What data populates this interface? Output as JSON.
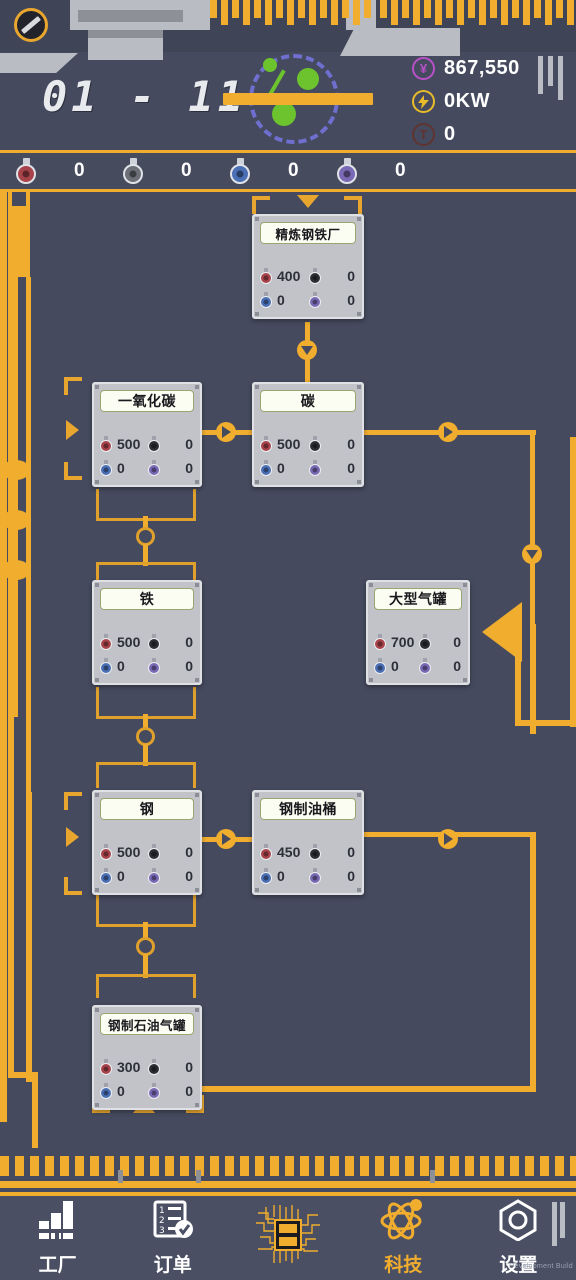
{
  "header": {
    "level_label": "01 - 11",
    "knob_icon": "dial-knob-icon",
    "logo_icon": "molecule-logo-icon",
    "stats": [
      {
        "icon": "money-icon",
        "symbol": "¥",
        "value": "867,550",
        "color": "#b851c8"
      },
      {
        "icon": "power-icon",
        "symbol": "⚡",
        "value": "0KW",
        "color": "#e8bb2b"
      },
      {
        "icon": "pollution-icon",
        "symbol": "T",
        "value": "0",
        "color": "#5f3430"
      }
    ]
  },
  "resource_bar": {
    "items": [
      {
        "icon": "flask-red-icon",
        "color": "#a8434b",
        "value": "0"
      },
      {
        "icon": "flask-grey-icon",
        "color": "#6c6f77",
        "value": "0"
      },
      {
        "icon": "flask-blue-icon",
        "color": "#4a6fb5",
        "value": "0"
      },
      {
        "icon": "flask-purple-icon",
        "color": "#7a6ab5",
        "value": "0"
      }
    ]
  },
  "board": {
    "nodes": [
      {
        "id": "refined-steel-plant",
        "title": "精炼钢铁厂",
        "stats": [
          {
            "icon": "flask-red-icon",
            "color": "#a8434b",
            "value": "400"
          },
          {
            "icon": "flask-grey-icon",
            "color": "#2c2e33",
            "value": "0"
          },
          {
            "icon": "flask-blue-icon",
            "color": "#4a6fb5",
            "value": "0"
          },
          {
            "icon": "flask-purple-icon",
            "color": "#7a6ab5",
            "value": "0"
          }
        ]
      },
      {
        "id": "carbon-monoxide",
        "title": "一氧化碳",
        "stats": [
          {
            "icon": "flask-red-icon",
            "color": "#a8434b",
            "value": "500"
          },
          {
            "icon": "flask-grey-icon",
            "color": "#2c2e33",
            "value": "0"
          },
          {
            "icon": "flask-blue-icon",
            "color": "#4a6fb5",
            "value": "0"
          },
          {
            "icon": "flask-purple-icon",
            "color": "#7a6ab5",
            "value": "0"
          }
        ]
      },
      {
        "id": "carbon",
        "title": "碳",
        "stats": [
          {
            "icon": "flask-red-icon",
            "color": "#a8434b",
            "value": "500"
          },
          {
            "icon": "flask-grey-icon",
            "color": "#2c2e33",
            "value": "0"
          },
          {
            "icon": "flask-blue-icon",
            "color": "#4a6fb5",
            "value": "0"
          },
          {
            "icon": "flask-purple-icon",
            "color": "#7a6ab5",
            "value": "0"
          }
        ]
      },
      {
        "id": "iron",
        "title": "铁",
        "stats": [
          {
            "icon": "flask-red-icon",
            "color": "#a8434b",
            "value": "500"
          },
          {
            "icon": "flask-grey-icon",
            "color": "#2c2e33",
            "value": "0"
          },
          {
            "icon": "flask-blue-icon",
            "color": "#4a6fb5",
            "value": "0"
          },
          {
            "icon": "flask-purple-icon",
            "color": "#7a6ab5",
            "value": "0"
          }
        ]
      },
      {
        "id": "large-gas-tank",
        "title": "大型气罐",
        "stats": [
          {
            "icon": "flask-red-icon",
            "color": "#a8434b",
            "value": "700"
          },
          {
            "icon": "flask-grey-icon",
            "color": "#2c2e33",
            "value": "0"
          },
          {
            "icon": "flask-blue-icon",
            "color": "#4a6fb5",
            "value": "0"
          },
          {
            "icon": "flask-purple-icon",
            "color": "#7a6ab5",
            "value": "0"
          }
        ]
      },
      {
        "id": "steel",
        "title": "钢",
        "stats": [
          {
            "icon": "flask-red-icon",
            "color": "#a8434b",
            "value": "500"
          },
          {
            "icon": "flask-grey-icon",
            "color": "#2c2e33",
            "value": "0"
          },
          {
            "icon": "flask-blue-icon",
            "color": "#4a6fb5",
            "value": "0"
          },
          {
            "icon": "flask-purple-icon",
            "color": "#7a6ab5",
            "value": "0"
          }
        ]
      },
      {
        "id": "steel-oil-drum",
        "title": "钢制油桶",
        "stats": [
          {
            "icon": "flask-red-icon",
            "color": "#a8434b",
            "value": "450"
          },
          {
            "icon": "flask-grey-icon",
            "color": "#2c2e33",
            "value": "0"
          },
          {
            "icon": "flask-blue-icon",
            "color": "#4a6fb5",
            "value": "0"
          },
          {
            "icon": "flask-purple-icon",
            "color": "#7a6ab5",
            "value": "0"
          }
        ]
      },
      {
        "id": "steel-lpg-tank",
        "title": "钢制石油气罐",
        "stats": [
          {
            "icon": "flask-red-icon",
            "color": "#a8434b",
            "value": "300"
          },
          {
            "icon": "flask-grey-icon",
            "color": "#2c2e33",
            "value": "0"
          },
          {
            "icon": "flask-blue-icon",
            "color": "#4a6fb5",
            "value": "0"
          },
          {
            "icon": "flask-purple-icon",
            "color": "#7a6ab5",
            "value": "0"
          }
        ]
      }
    ]
  },
  "navbar": {
    "items": [
      {
        "id": "factory",
        "icon": "factory-icon",
        "label": "工厂",
        "active": false
      },
      {
        "id": "orders",
        "icon": "clipboard-check-icon",
        "label": "订单",
        "active": false
      },
      {
        "id": "chip",
        "icon": "microchip-icon",
        "label": "",
        "active": false
      },
      {
        "id": "tech",
        "icon": "atom-icon",
        "label": "科技",
        "active": true
      },
      {
        "id": "settings",
        "icon": "hex-gear-icon",
        "label": "设置",
        "active": false
      }
    ],
    "watermark": "Development Build"
  },
  "accent": {
    "orange": "#f0ad2e",
    "bg": "#454a5e",
    "panel": "#c1c3c8"
  }
}
